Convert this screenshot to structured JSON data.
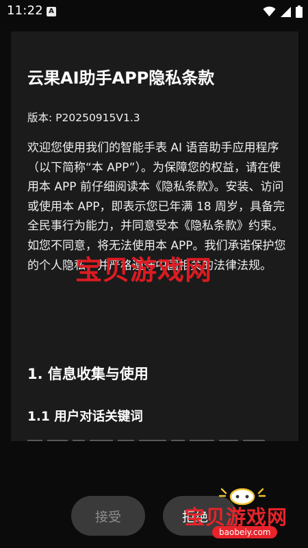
{
  "status_bar": {
    "time": "11:22",
    "badge": "A"
  },
  "document": {
    "title": "云果AI助手APP隐私条款",
    "version": "版本: P20250915V1.3",
    "intro": "欢迎您使用我们的智能手表 AI 语音助手应用程序（以下简称“本 APP”）。为保障您的权益，请在使用本 APP 前仔细阅读本《隐私条款》。安装、访问或使用本 APP，即表示您已年满 18 周岁，具备完全民事行为能力，并同意受本《隐私条款》约束。如您不同意，将无法使用本 APP。我们承诺保护您的个人隐私，并严格遵守中国相关的法律法规。",
    "section_1": "1. 信息收集与使用",
    "section_1_1": "1.1 用户对话关键词"
  },
  "buttons": {
    "accept": "接受",
    "reject": "拒绝"
  },
  "watermark": {
    "text": "宝贝游戏网",
    "logo_text": "宝贝游戏网",
    "logo_url": "baobeiy.com"
  },
  "colors": {
    "background": "#0b0b0b",
    "card": "#1b1b1b",
    "button": "#3a3a3a",
    "watermark": "#e31b23"
  },
  "icons": [
    "wifi-icon",
    "signal-icon",
    "battery-icon"
  ]
}
